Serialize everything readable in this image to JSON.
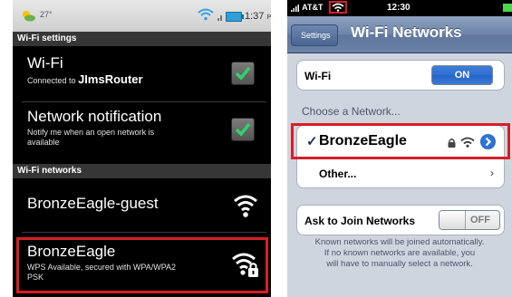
{
  "android": {
    "status": {
      "temperature": "27°",
      "time": "1:37",
      "ampm": "PM"
    },
    "wifi_settings_header": "Wi-Fi settings",
    "wifi": {
      "title": "Wi-Fi",
      "sub_prefix": "Connected to",
      "network": "JImsRouter",
      "checked": true
    },
    "notification": {
      "title": "Network notification",
      "sub_line1": "Notify me when an open network is",
      "sub_line2": "available",
      "checked": true
    },
    "networks_header": "Wi-Fi networks",
    "networks": [
      {
        "name": "BronzeEagle-guest",
        "detail_line1": "",
        "detail_line2": "",
        "secured": false
      },
      {
        "name": "BronzeEagle",
        "detail_line1": "WPS Available, secured with WPA/WPA2",
        "detail_line2": "PSK",
        "secured": true,
        "highlighted": true
      }
    ]
  },
  "ios": {
    "status": {
      "carrier": "AT&T",
      "time": "12:30"
    },
    "nav": {
      "back": "Settings",
      "title": "Wi-Fi Networks"
    },
    "wifi_label": "Wi-Fi",
    "wifi_toggle": "ON",
    "choose_label": "Choose a Network...",
    "selected_network": "BronzeEagle",
    "checkmark": "✓",
    "other_label": "Other...",
    "ask_label": "Ask to Join Networks",
    "ask_toggle": "OFF",
    "footer_line1": "Known networks will be joined automatically.",
    "footer_line2": "If no known networks are available, you",
    "footer_line3": "will have to manually select a network."
  },
  "colors": {
    "highlight_red": "#d61f26",
    "android_check_green": "#2fd36a",
    "ios_blue": "#2f6fd0"
  }
}
